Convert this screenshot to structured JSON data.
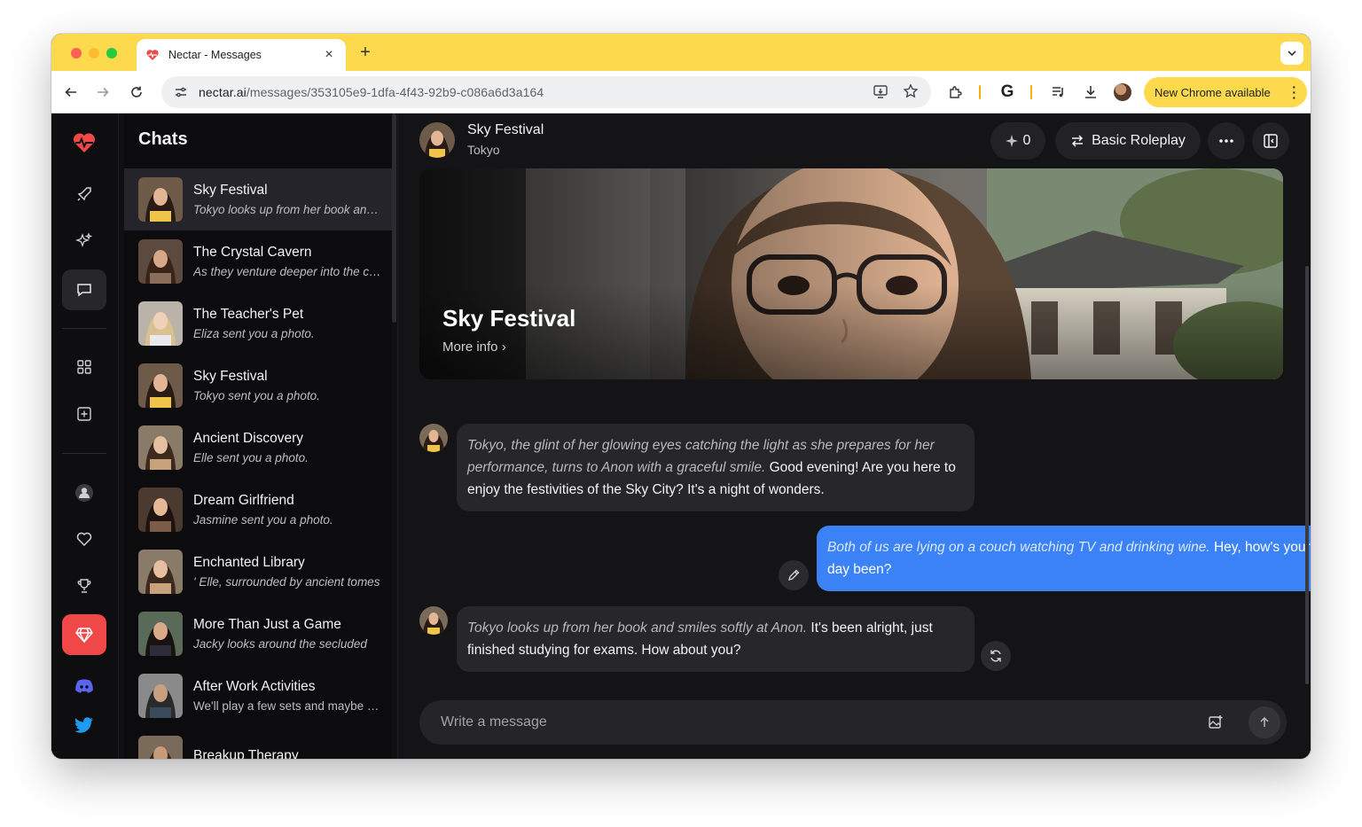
{
  "browser": {
    "tab_title": "Nectar - Messages",
    "url_host": "nectar.ai",
    "url_path": "/messages/353105e9-1dfa-4f43-92b9-c086a6d3a164",
    "update_label": "New Chrome available",
    "extension_letter": "G"
  },
  "sidebar": {
    "title": "Chats",
    "chats": [
      {
        "name": "Sky Festival",
        "preview": "Tokyo looks up from her book and smiles softly at Anon.",
        "italic": true
      },
      {
        "name": "The Crystal Cavern",
        "preview": "As they venture deeper into the cavern",
        "italic": true
      },
      {
        "name": "The Teacher's Pet",
        "preview": "Eliza sent you a photo.",
        "italic": true
      },
      {
        "name": "Sky Festival",
        "preview": "Tokyo sent you a photo.",
        "italic": true
      },
      {
        "name": "Ancient Discovery",
        "preview": "Elle sent you a photo.",
        "italic": true
      },
      {
        "name": "Dream Girlfriend",
        "preview": "Jasmine sent you a photo.",
        "italic": true
      },
      {
        "name": "Enchanted Library",
        "preview": "' Elle, surrounded by ancient tomes",
        "italic": true
      },
      {
        "name": "More Than Just a Game",
        "preview": "Jacky looks around the secluded",
        "italic": true
      },
      {
        "name": "After Work Activities",
        "preview": "We'll play a few sets and maybe grab a drink",
        "italic": false
      },
      {
        "name": "Breakup Therapy",
        "preview": "",
        "italic": false
      }
    ]
  },
  "conversation": {
    "title": "Sky Festival",
    "character": "Tokyo",
    "counter": "0",
    "mode_label": "Basic Roleplay",
    "hero_title": "Sky Festival",
    "hero_more": "More info",
    "messages": [
      {
        "from": "bot",
        "action": "Tokyo, the glint of her glowing eyes catching the light as she prepares for her performance, turns to Anon with a graceful smile.",
        "text": " Good evening! Are you here to enjoy the festivities of the Sky City? It's a night of wonders."
      },
      {
        "from": "user",
        "action": "Both of us are lying on a couch watching TV and drinking wine.",
        "text": " Hey, how's your day been?"
      },
      {
        "from": "bot",
        "action": "Tokyo looks up from her book and smiles softly at Anon.",
        "text": " It's been alright, just finished studying for exams. How about you?"
      }
    ],
    "input_placeholder": "Write a message"
  },
  "icons": {
    "logo": "heartbeat-icon",
    "rail": [
      "rocket-icon",
      "sparkles-icon",
      "chat-bubble-icon",
      "grid-icon",
      "plus-square-icon",
      "user-icon",
      "heart-icon",
      "trophy-icon",
      "gem-icon",
      "discord-icon",
      "twitter-icon"
    ]
  },
  "colors": {
    "chrome_accent": "#fdd94e",
    "brand_red": "#f04848",
    "user_bubble": "#3b82f6"
  }
}
